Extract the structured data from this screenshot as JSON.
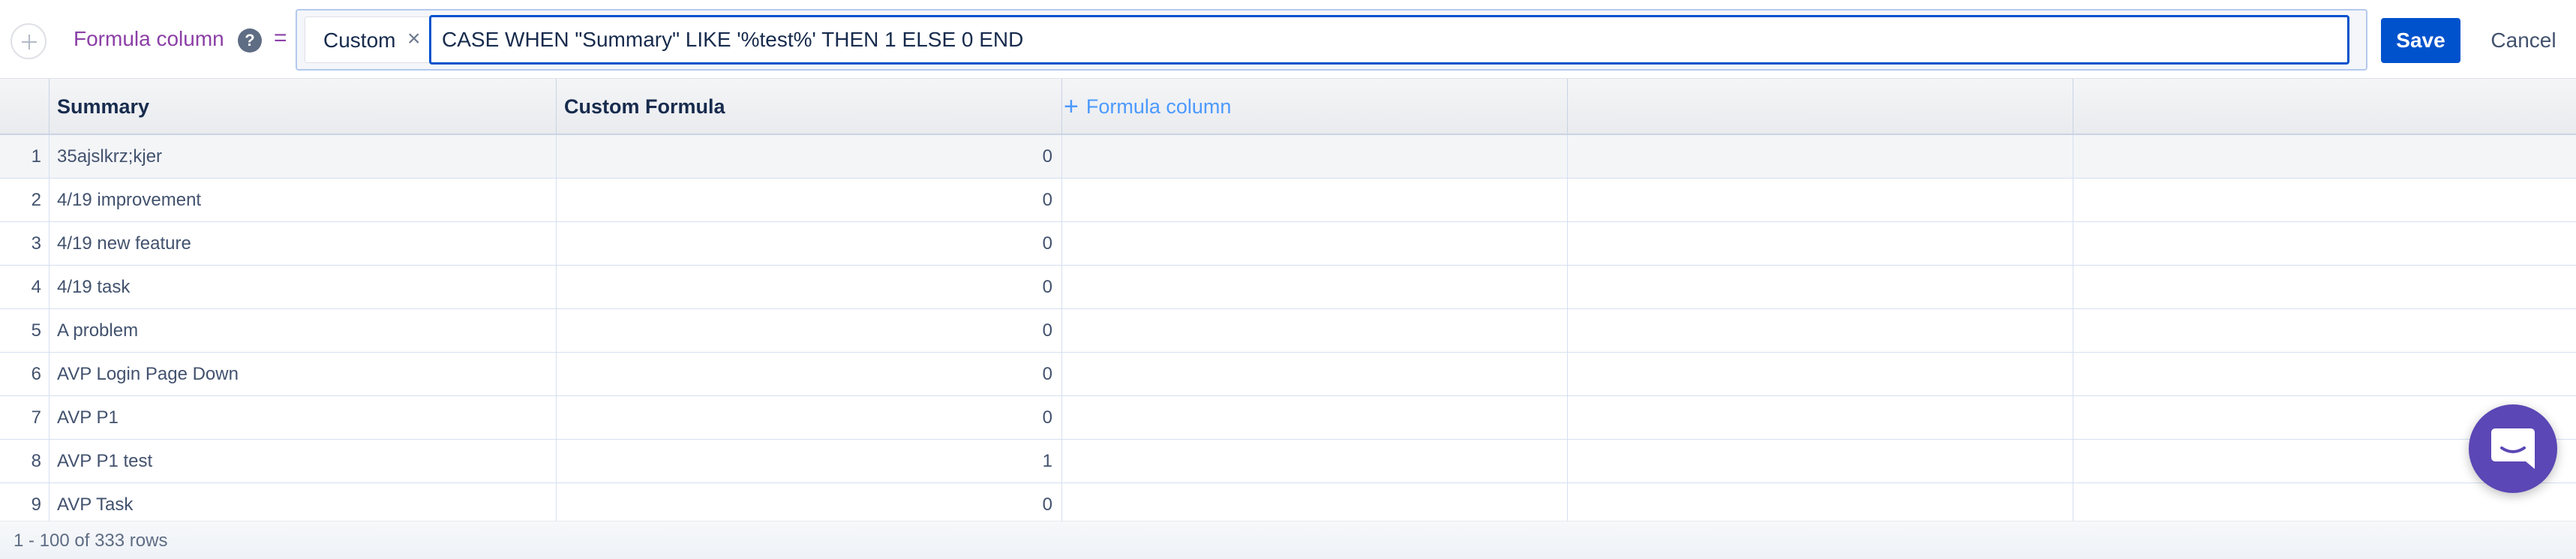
{
  "formula_bar": {
    "label": "Formula column",
    "help_symbol": "?",
    "equals": "=",
    "function_tag": "Custom",
    "function_tag_close": "×",
    "expression": "CASE WHEN \"Summary\" LIKE '%test%' THEN 1 ELSE 0 END",
    "save_label": "Save",
    "cancel_label": "Cancel"
  },
  "table": {
    "columns": [
      "Summary",
      "Custom Formula"
    ],
    "add_column_label": "Formula column",
    "add_column_symbol": "+",
    "rows": [
      {
        "n": "1",
        "summary": "35ajslkrz;kjer",
        "formula": "0"
      },
      {
        "n": "2",
        "summary": "4/19 improvement",
        "formula": "0"
      },
      {
        "n": "3",
        "summary": "4/19 new feature",
        "formula": "0"
      },
      {
        "n": "4",
        "summary": "4/19 task",
        "formula": "0"
      },
      {
        "n": "5",
        "summary": "A problem",
        "formula": "0"
      },
      {
        "n": "6",
        "summary": "AVP Login Page Down",
        "formula": "0"
      },
      {
        "n": "7",
        "summary": "AVP P1",
        "formula": "0"
      },
      {
        "n": "8",
        "summary": "AVP P1 test",
        "formula": "1"
      },
      {
        "n": "9",
        "summary": "AVP Task",
        "formula": "0"
      }
    ]
  },
  "footer": {
    "row_count": "1 - 100 of 333 rows"
  },
  "colors": {
    "accent": "#0052cc",
    "formula_label": "#8b3fa6",
    "chat_button": "#5b47b5"
  },
  "icons": [
    "add-column-circle-icon",
    "help-icon",
    "close-icon",
    "plus-icon",
    "chat-icon"
  ]
}
